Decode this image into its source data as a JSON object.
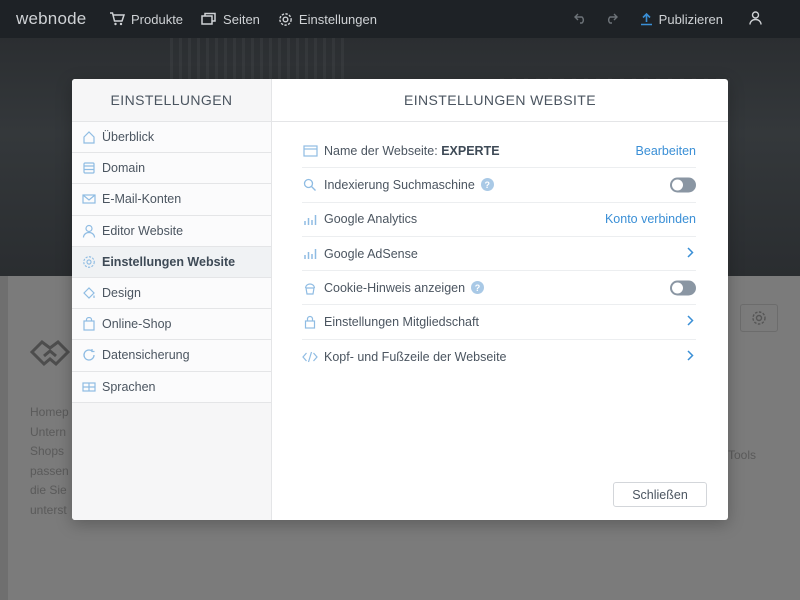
{
  "app": {
    "logo": "webnode"
  },
  "topbar": {
    "nav": [
      {
        "label": "Produkte",
        "icon": "cart-icon"
      },
      {
        "label": "Seiten",
        "icon": "pages-icon"
      },
      {
        "label": "Einstellungen",
        "icon": "gear-icon"
      }
    ],
    "publish_label": "Publizieren"
  },
  "background": {
    "text_lines": [
      "Homep",
      "Untern",
      "Shops",
      "passen",
      "die Sie",
      "unterst"
    ],
    "right_text": "Tools"
  },
  "modal": {
    "sidebar": {
      "title": "EINSTELLUNGEN",
      "items": [
        {
          "label": "Überblick",
          "icon": "home-icon",
          "active": false
        },
        {
          "label": "Domain",
          "icon": "domain-icon",
          "active": false
        },
        {
          "label": "E-Mail-Konten",
          "icon": "mail-icon",
          "active": false
        },
        {
          "label": "Editor Website",
          "icon": "user-icon",
          "active": false
        },
        {
          "label": "Einstellungen Website",
          "icon": "gear-icon",
          "active": true
        },
        {
          "label": "Design",
          "icon": "paint-bucket-icon",
          "active": false
        },
        {
          "label": "Online-Shop",
          "icon": "shopping-bag-icon",
          "active": false
        },
        {
          "label": "Datensicherung",
          "icon": "backup-icon",
          "active": false
        },
        {
          "label": "Sprachen",
          "icon": "flags-icon",
          "active": false
        }
      ]
    },
    "content": {
      "title": "EINSTELLUNGEN WEBSITE",
      "rows": [
        {
          "label": "Name der Webseite:",
          "value": "EXPERTE",
          "action": "Bearbeiten",
          "icon": "browser-window-icon"
        },
        {
          "label": "Indexierung Suchmaschine",
          "help": "?",
          "toggle": false,
          "icon": "search-icon"
        },
        {
          "label": "Google Analytics",
          "action": "Konto verbinden",
          "icon": "bar-chart-icon"
        },
        {
          "label": "Google AdSense",
          "icon": "bar-chart-icon"
        },
        {
          "label": "Cookie-Hinweis anzeigen",
          "help": "?",
          "toggle": false,
          "icon": "cupcake-icon"
        },
        {
          "label": "Einstellungen Mitgliedschaft",
          "icon": "lock-icon"
        },
        {
          "label": "Kopf- und Fußzeile der Webseite",
          "icon": "code-icon"
        }
      ],
      "close_label": "Schließen"
    }
  },
  "colors": {
    "accent": "#3a8fd6",
    "topbar": "#1e2226",
    "toggle_off": "#8a96a3"
  }
}
